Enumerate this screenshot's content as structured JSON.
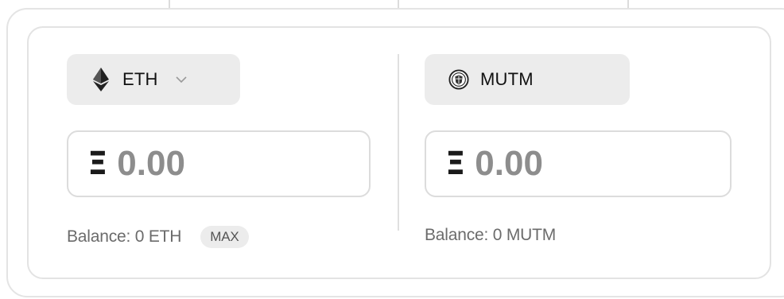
{
  "pay": {
    "token": "ETH",
    "token_icon": "ethereum-icon",
    "amount_placeholder": "0.00",
    "currency_symbol": "Ξ",
    "balance_text": "Balance: 0 ETH",
    "max_label": "MAX"
  },
  "receive": {
    "token": "MUTM",
    "token_icon": "mutm-logo-icon",
    "amount_placeholder": "0.00",
    "currency_symbol": "Ξ",
    "balance_text": "Balance: 0 MUTM"
  },
  "colors": {
    "panel_border": "#e3e3e3",
    "selector_bg": "#ececec",
    "amount_text": "#8d8d8d"
  }
}
